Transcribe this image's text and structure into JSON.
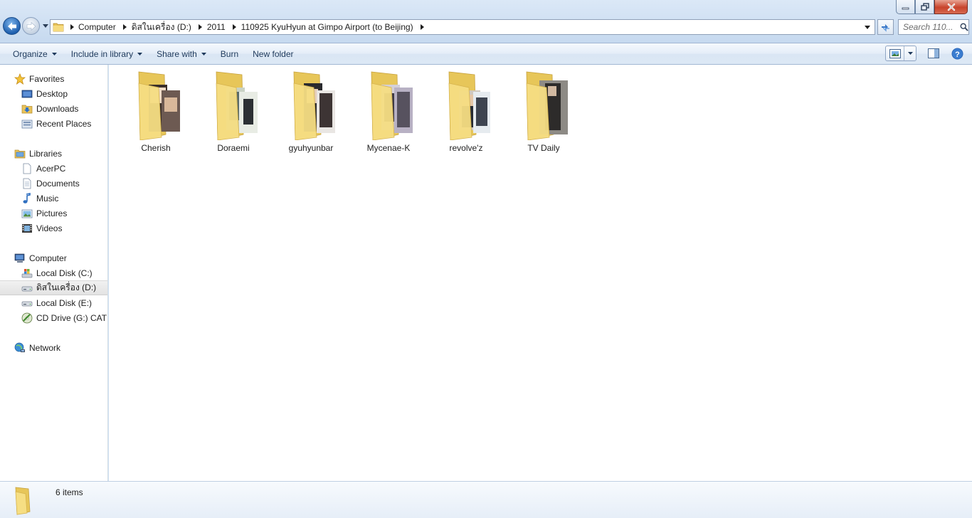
{
  "window": {
    "controls": {
      "minimize": "minimize",
      "maximize": "restore",
      "close": "close"
    }
  },
  "addressbar": {
    "crumbs": [
      {
        "label": "Computer"
      },
      {
        "label": "ดิสในเครื่อง (D:)"
      },
      {
        "label": "2011"
      },
      {
        "label": "110925 KyuHyun at Gimpo Airport (to Beijing)"
      }
    ]
  },
  "search": {
    "placeholder": "Search 110..."
  },
  "toolbar": {
    "organize": "Organize",
    "include_in_library": "Include in library",
    "share_with": "Share with",
    "burn": "Burn",
    "new_folder": "New folder"
  },
  "navpane": {
    "favorites": {
      "label": "Favorites",
      "items": [
        "Desktop",
        "Downloads",
        "Recent Places"
      ]
    },
    "libraries": {
      "label": "Libraries",
      "items": [
        "AcerPC",
        "Documents",
        "Music",
        "Pictures",
        "Videos"
      ]
    },
    "computer": {
      "label": "Computer",
      "items": [
        "Local Disk (C:)",
        "ดิสในเครื่อง (D:)",
        "Local Disk (E:)",
        "CD Drive (G:) CAT C"
      ]
    },
    "network": {
      "label": "Network"
    }
  },
  "folders": [
    {
      "name": "Cherish"
    },
    {
      "name": "Doraemi"
    },
    {
      "name": "gyuhyunbar"
    },
    {
      "name": "Mycenae-K"
    },
    {
      "name": "revolve'z"
    },
    {
      "name": "TV Daily"
    }
  ],
  "status": {
    "item_count": "6 items"
  },
  "colors": {
    "accent": "#1e395b",
    "folder": "#f3d674",
    "close": "#c8432c"
  }
}
